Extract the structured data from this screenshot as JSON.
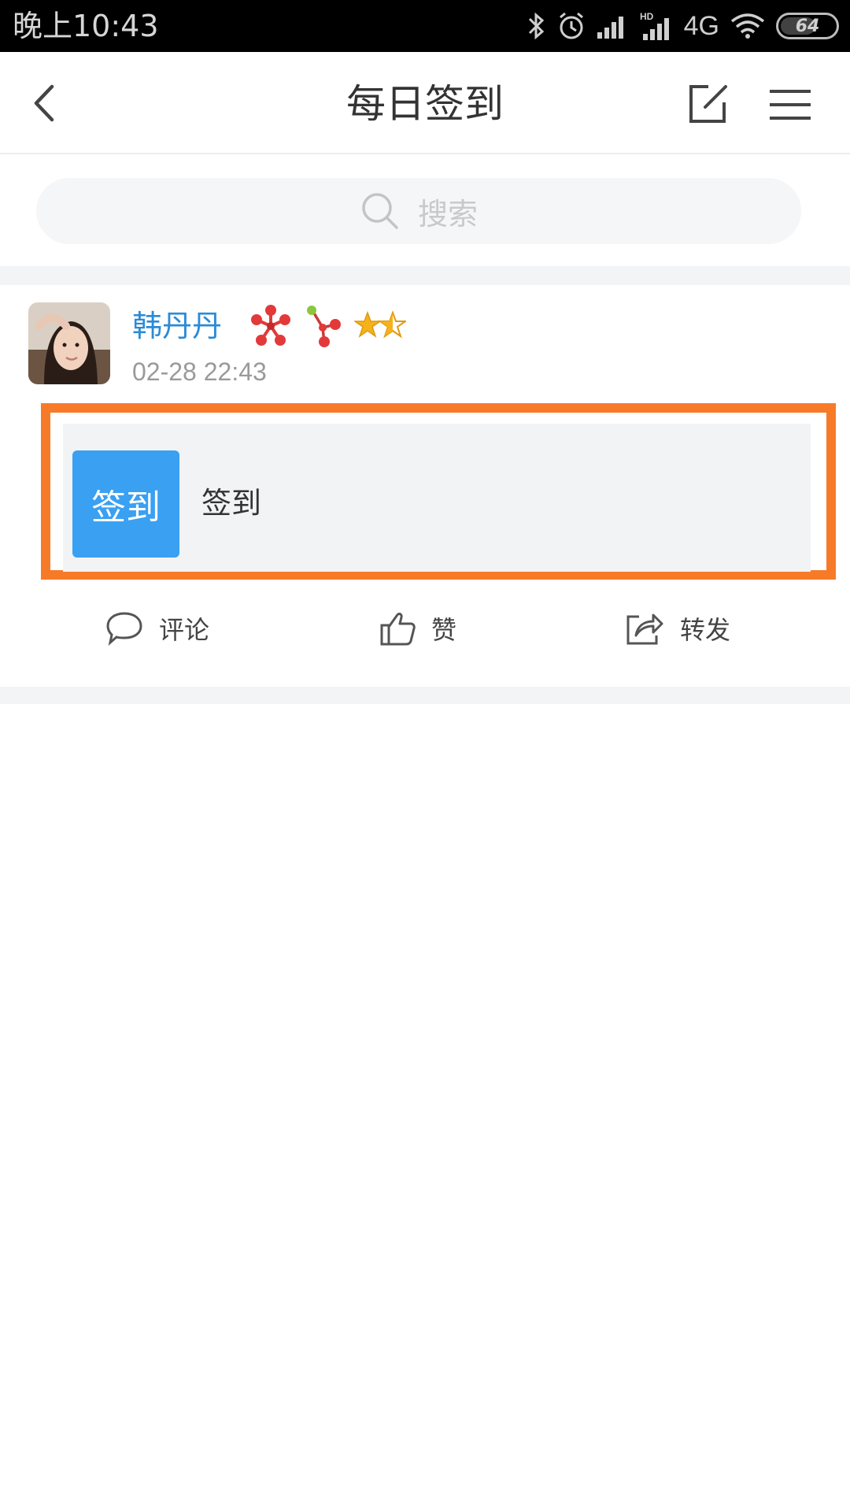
{
  "status_bar": {
    "time": "晚上10:43",
    "network": "4G",
    "network_hd": "HD",
    "battery": "64"
  },
  "header": {
    "title": "每日签到",
    "back_icon": "back-chevron-icon",
    "edit_icon": "edit-icon",
    "menu_icon": "menu-icon"
  },
  "search": {
    "placeholder": "搜索",
    "icon": "search-icon"
  },
  "post": {
    "user_name": "韩丹丹",
    "time": "02-28 22:43",
    "badges": [
      "flower-badge-icon",
      "sprout-badge-icon",
      "star-rating-icon"
    ],
    "card": {
      "tag_label": "签到",
      "text": "签到"
    },
    "actions": [
      {
        "label": "评论",
        "icon": "comment-icon"
      },
      {
        "label": "赞",
        "icon": "thumbs-up-icon"
      },
      {
        "label": "转发",
        "icon": "share-icon"
      }
    ]
  },
  "colors": {
    "accent_blue": "#3aa0f2",
    "name_blue": "#2b8bd6",
    "highlight_orange": "#f77a29"
  }
}
